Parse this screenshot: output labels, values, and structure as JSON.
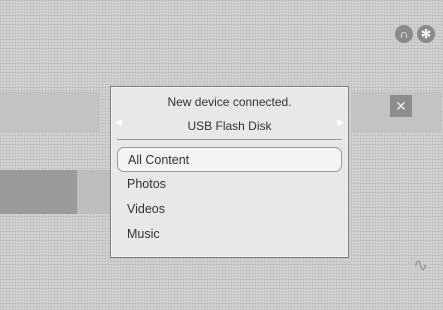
{
  "dialog": {
    "title": "New device connected.",
    "device_name": "USB Flash Disk",
    "options": [
      "All Content",
      "Photos",
      "Videos",
      "Music"
    ],
    "selected_index": 0
  }
}
